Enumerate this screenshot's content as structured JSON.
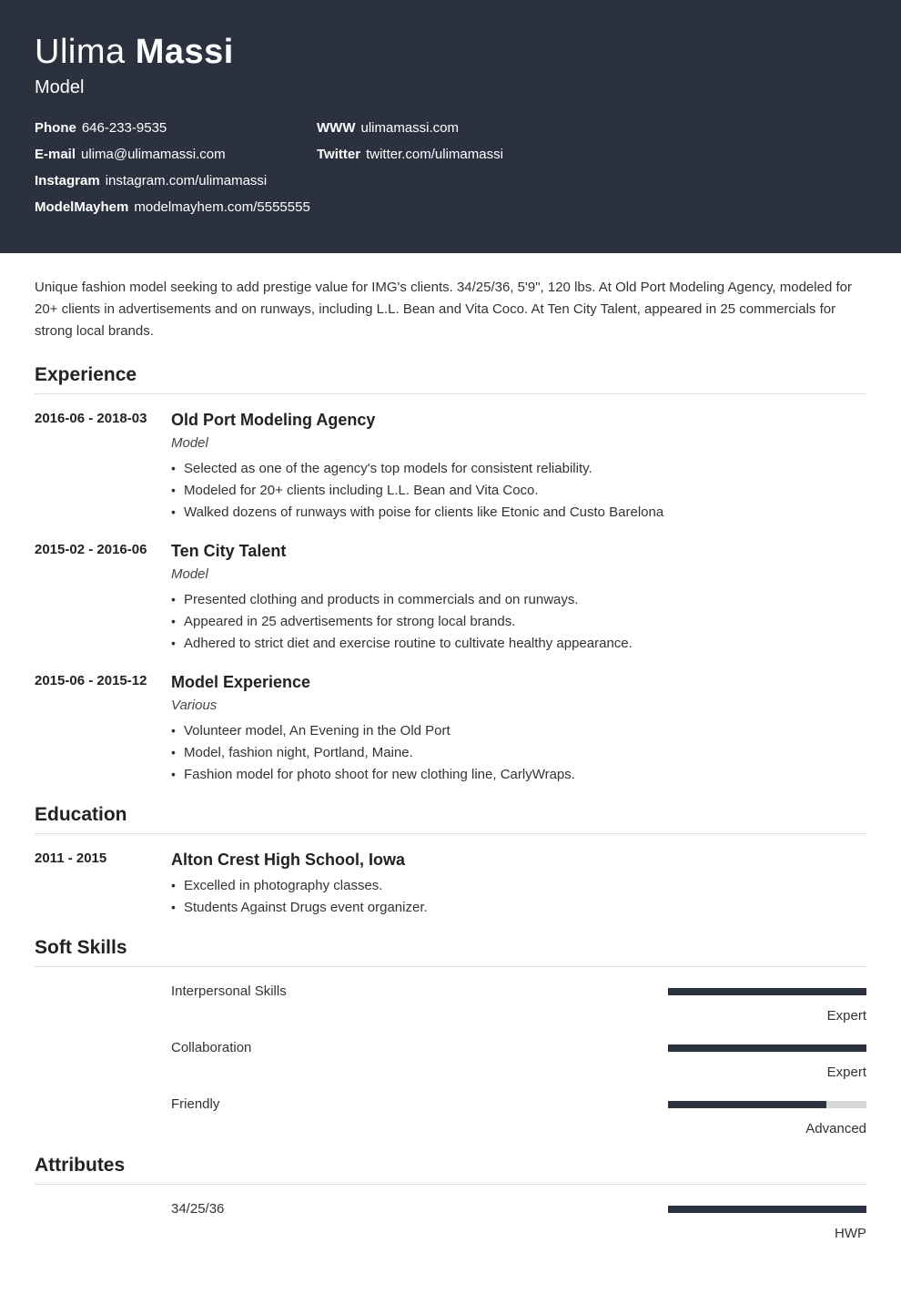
{
  "header": {
    "first_name": "Ulima",
    "last_name": "Massi",
    "job_title": "Model",
    "contacts_col1": [
      {
        "label": "Phone",
        "value": "646-233-9535"
      },
      {
        "label": "E-mail",
        "value": "ulima@ulimamassi.com"
      },
      {
        "label": "Instagram",
        "value": "instagram.com/ulimamassi"
      },
      {
        "label": "ModelMayhem",
        "value": "modelmayhem.com/5555555"
      }
    ],
    "contacts_col2": [
      {
        "label": "WWW",
        "value": "ulimamassi.com"
      },
      {
        "label": "Twitter",
        "value": "twitter.com/ulimamassi"
      }
    ]
  },
  "summary": "Unique fashion model seeking to add prestige value for IMG's clients. 34/25/36, 5'9\", 120 lbs. At Old Port Modeling Agency, modeled for 20+ clients in advertisements and on runways, including L.L. Bean and Vita Coco. At Ten City Talent, appeared in 25 commercials for strong local brands.",
  "sections": {
    "experience_title": "Experience",
    "education_title": "Education",
    "softskills_title": "Soft Skills",
    "attributes_title": "Attributes"
  },
  "experience": [
    {
      "dates": "2016-06 - 2018-03",
      "title": "Old Port Modeling Agency",
      "sub": "Model",
      "bullets": [
        "Selected as one of the agency's top models for consistent reliability.",
        "Modeled for 20+ clients including L.L. Bean and Vita Coco.",
        "Walked dozens of runways with poise for clients like Etonic and Custo Barelona"
      ]
    },
    {
      "dates": "2015-02 - 2016-06",
      "title": "Ten City Talent",
      "sub": "Model",
      "bullets": [
        "Presented clothing and products in commercials and on runways.",
        "Appeared in 25 advertisements for strong local brands.",
        "Adhered to strict diet and exercise routine to cultivate healthy appearance."
      ]
    },
    {
      "dates": "2015-06 - 2015-12",
      "title": "Model Experience",
      "sub": "Various",
      "bullets": [
        "Volunteer model, An Evening in the Old Port",
        "Model, fashion night, Portland, Maine.",
        "Fashion model for photo shoot for new clothing line, CarlyWraps."
      ]
    }
  ],
  "education": [
    {
      "dates": "2011 - 2015",
      "title": "Alton Crest High School, Iowa",
      "bullets": [
        "Excelled in photography classes.",
        "Students Against Drugs event organizer."
      ]
    }
  ],
  "softskills": [
    {
      "name": "Interpersonal Skills",
      "level": "Expert",
      "pct": 100
    },
    {
      "name": "Collaboration",
      "level": "Expert",
      "pct": 100
    },
    {
      "name": "Friendly",
      "level": "Advanced",
      "pct": 80
    }
  ],
  "attributes": [
    {
      "name": "34/25/36",
      "level": "HWP",
      "pct": 100
    }
  ]
}
